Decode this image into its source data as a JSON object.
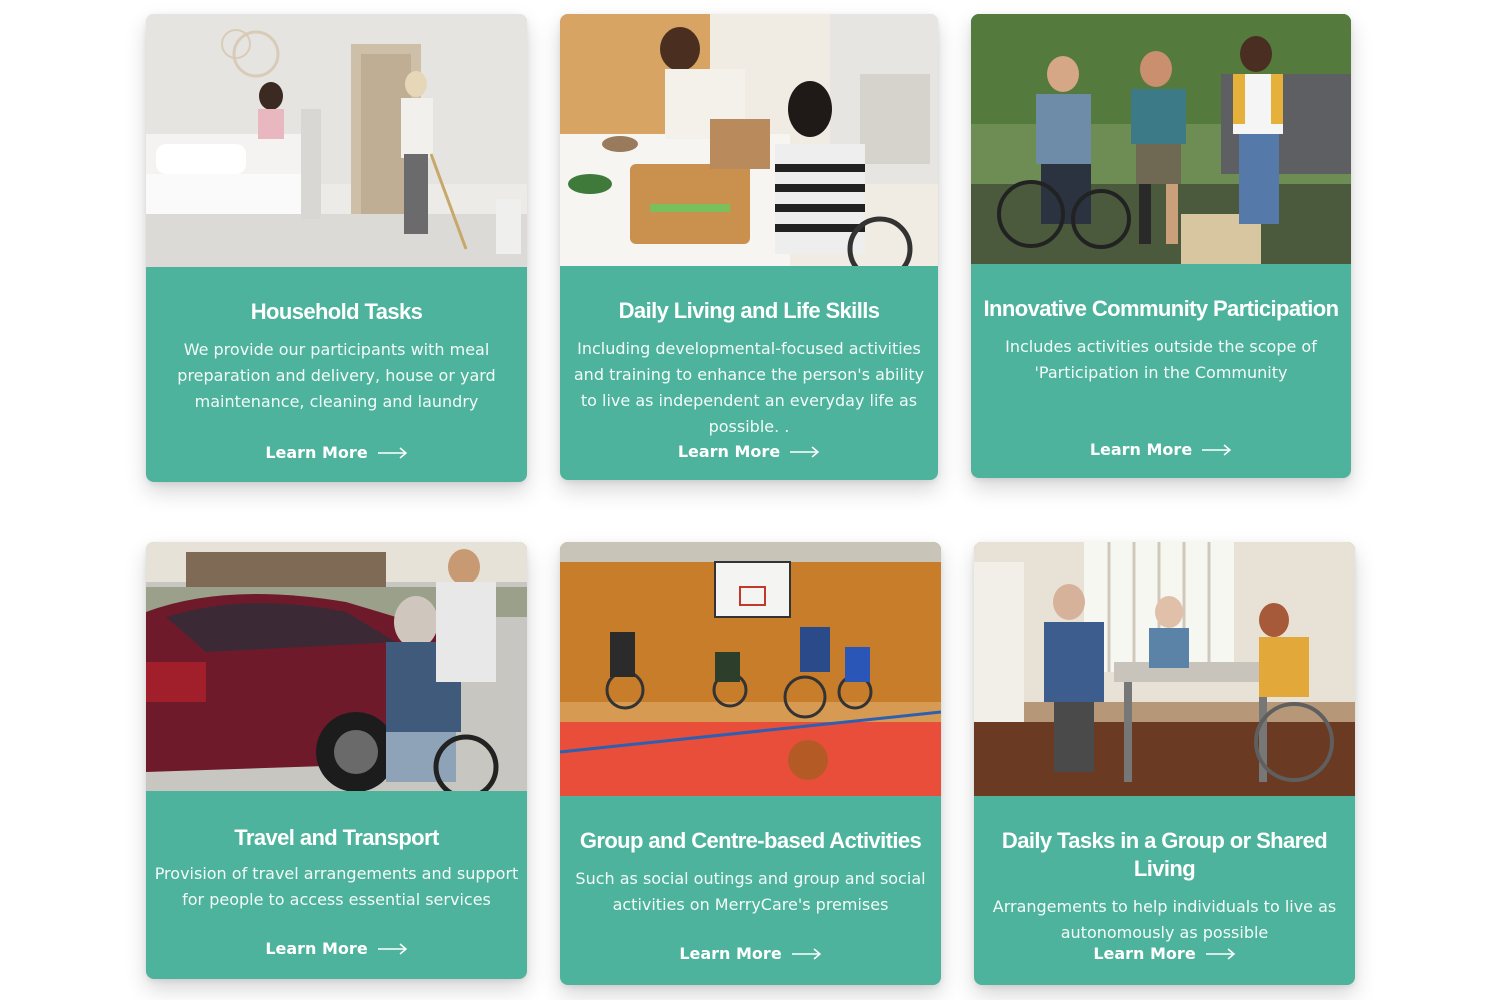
{
  "cards": [
    {
      "title": "Household Tasks",
      "description": "We provide our participants with meal preparation and delivery, house or yard maintenance, cleaning and laundry",
      "link_label": "Learn More",
      "image_subject": "two women making a bed and sweeping a bright bedroom"
    },
    {
      "title": "Daily Living and Life Skills",
      "description": "Including developmental-focused activities and training to enhance the person's ability to live as independent an everyday life as possible. .",
      "link_label": "Learn More",
      "image_subject": "woman in a wheelchair chopping vegetables in a kitchen with a man"
    },
    {
      "title": "Innovative Community Participation",
      "description": "Includes activities outside the scope of 'Participation in the Community",
      "link_label": "Learn More",
      "image_subject": "group of friends playing cornhole outdoors, one in a wheelchair"
    },
    {
      "title": "Travel and Transport",
      "description": "Provision of travel arrangements and support for people to access essential services",
      "link_label": "Learn More",
      "image_subject": "volunteer helping an older man in a wheelchair beside a red car"
    },
    {
      "title": "Group and Centre-based Activities",
      "description": "Such as social outings and group and social activities on MerryCare's premises",
      "link_label": "Learn More",
      "image_subject": "wheelchair basketball players on an indoor court"
    },
    {
      "title": "Daily Tasks in a Group or Shared Living",
      "description": "Arrangements to help individuals to live as autonomously as possible",
      "link_label": "Learn More",
      "image_subject": "older adults sharing a meal at a dining table by a window"
    }
  ],
  "colors": {
    "card_background": "#4db39c",
    "text": "#ffffff",
    "page_background": "#ffffff"
  },
  "icons": {
    "link_arrow": "arrow-right-icon"
  }
}
